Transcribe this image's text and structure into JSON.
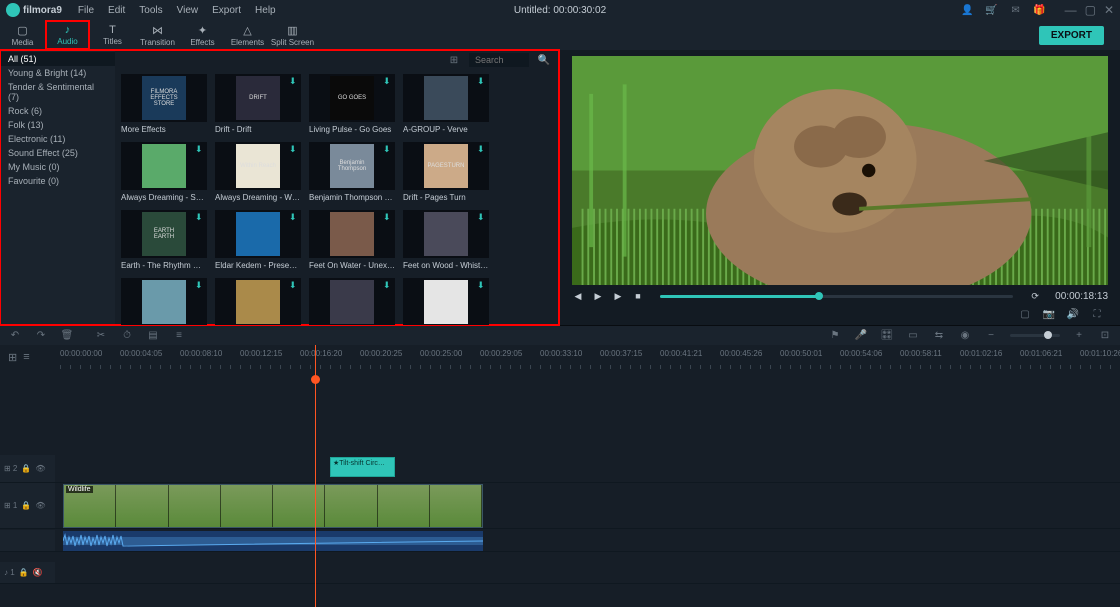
{
  "app": {
    "name": "filmora9",
    "title": "Untitled:  00:00:30:02"
  },
  "menu": [
    "File",
    "Edit",
    "Tools",
    "View",
    "Export",
    "Help"
  ],
  "tabs": [
    {
      "id": "media",
      "label": "Media",
      "icon": "▢"
    },
    {
      "id": "audio",
      "label": "Audio",
      "icon": "♪",
      "active": true
    },
    {
      "id": "titles",
      "label": "Titles",
      "icon": "T"
    },
    {
      "id": "transition",
      "label": "Transition",
      "icon": "⋈"
    },
    {
      "id": "effects",
      "label": "Effects",
      "icon": "✦"
    },
    {
      "id": "elements",
      "label": "Elements",
      "icon": "△"
    },
    {
      "id": "split",
      "label": "Split Screen",
      "icon": "▥"
    }
  ],
  "export_label": "EXPORT",
  "sidebar": [
    {
      "label": "All (51)",
      "sel": true
    },
    {
      "label": "Young & Bright (14)"
    },
    {
      "label": "Tender & Sentimental (7)"
    },
    {
      "label": "Rock (6)"
    },
    {
      "label": "Folk (13)"
    },
    {
      "label": "Electronic (11)"
    },
    {
      "label": "Sound Effect (25)"
    },
    {
      "label": "My Music (0)"
    },
    {
      "label": "Favourite (0)"
    }
  ],
  "search_placeholder": "Search",
  "thumbs": [
    [
      {
        "label": "More Effects",
        "art": "FILMORA EFFECTS STORE",
        "bg": "#1a3a5a"
      },
      {
        "label": "Drift - Drift",
        "art": "DRIFT",
        "bg": "#2a2a3a",
        "dl": true
      },
      {
        "label": "Living Pulse - Go Goes",
        "art": "GO GOES",
        "bg": "#0a0a0a",
        "dl": true
      },
      {
        "label": "A-GROUP - Verve",
        "art": "",
        "bg": "#3a4a5a",
        "dl": true
      }
    ],
    [
      {
        "label": "Always Dreaming - Same …",
        "art": "",
        "bg": "#5aaa6a",
        "dl": true
      },
      {
        "label": "Always Dreaming - Withi…",
        "art": "Within Reach",
        "bg": "#eae5d5",
        "dl": true
      },
      {
        "label": "Benjamin Thompson - Lul…",
        "art": "Benjamin Thompson",
        "bg": "#7a8a9a",
        "dl": true
      },
      {
        "label": "Drift - Pages Turn",
        "art": "PAGESTURN",
        "bg": "#ccaa88",
        "dl": true
      }
    ],
    [
      {
        "label": "Earth - The Rhythm Of M…",
        "art": "EARTH EARTH",
        "bg": "#2a4a3a",
        "dl": true
      },
      {
        "label": "Eldar Kedem - Present M…",
        "art": "",
        "bg": "#1a6aaa",
        "dl": true
      },
      {
        "label": "Feet On Water - Unexpec…",
        "art": "",
        "bg": "#7a5a4a",
        "dl": true
      },
      {
        "label": "Feet on Wood - Whistling…",
        "art": "",
        "bg": "#4a4a5a",
        "dl": true
      }
    ],
    [
      {
        "label": "",
        "art": "",
        "bg": "#6a9aaa",
        "dl": true
      },
      {
        "label": "",
        "art": "",
        "bg": "#aa8a4a",
        "dl": true
      },
      {
        "label": "",
        "art": "",
        "bg": "#3a3a4a",
        "dl": true
      },
      {
        "label": "",
        "art": "",
        "bg": "#e5e5e5",
        "dl": true
      }
    ]
  ],
  "preview": {
    "timecode": "00:00:18:13"
  },
  "ruler": [
    "00:00:00:00",
    "00:00:04:05",
    "00:00:08:10",
    "00:00:12:15",
    "00:00:16:20",
    "00:00:20:25",
    "00:00:25:00",
    "00:00:29:05",
    "00:00:33:10",
    "00:00:37:15",
    "00:00:41:21",
    "00:00:45:26",
    "00:00:50:01",
    "00:00:54:06",
    "00:00:58:11",
    "00:01:02:16",
    "00:01:06:21",
    "00:01:10:26"
  ],
  "tracks": {
    "fx": {
      "head": "⊞ 2",
      "clip": "Tilt-shift Circ…"
    },
    "video": {
      "head": "⊞ 1",
      "clip": "Wildlife"
    },
    "audio": {
      "head": "♪ 1"
    }
  }
}
